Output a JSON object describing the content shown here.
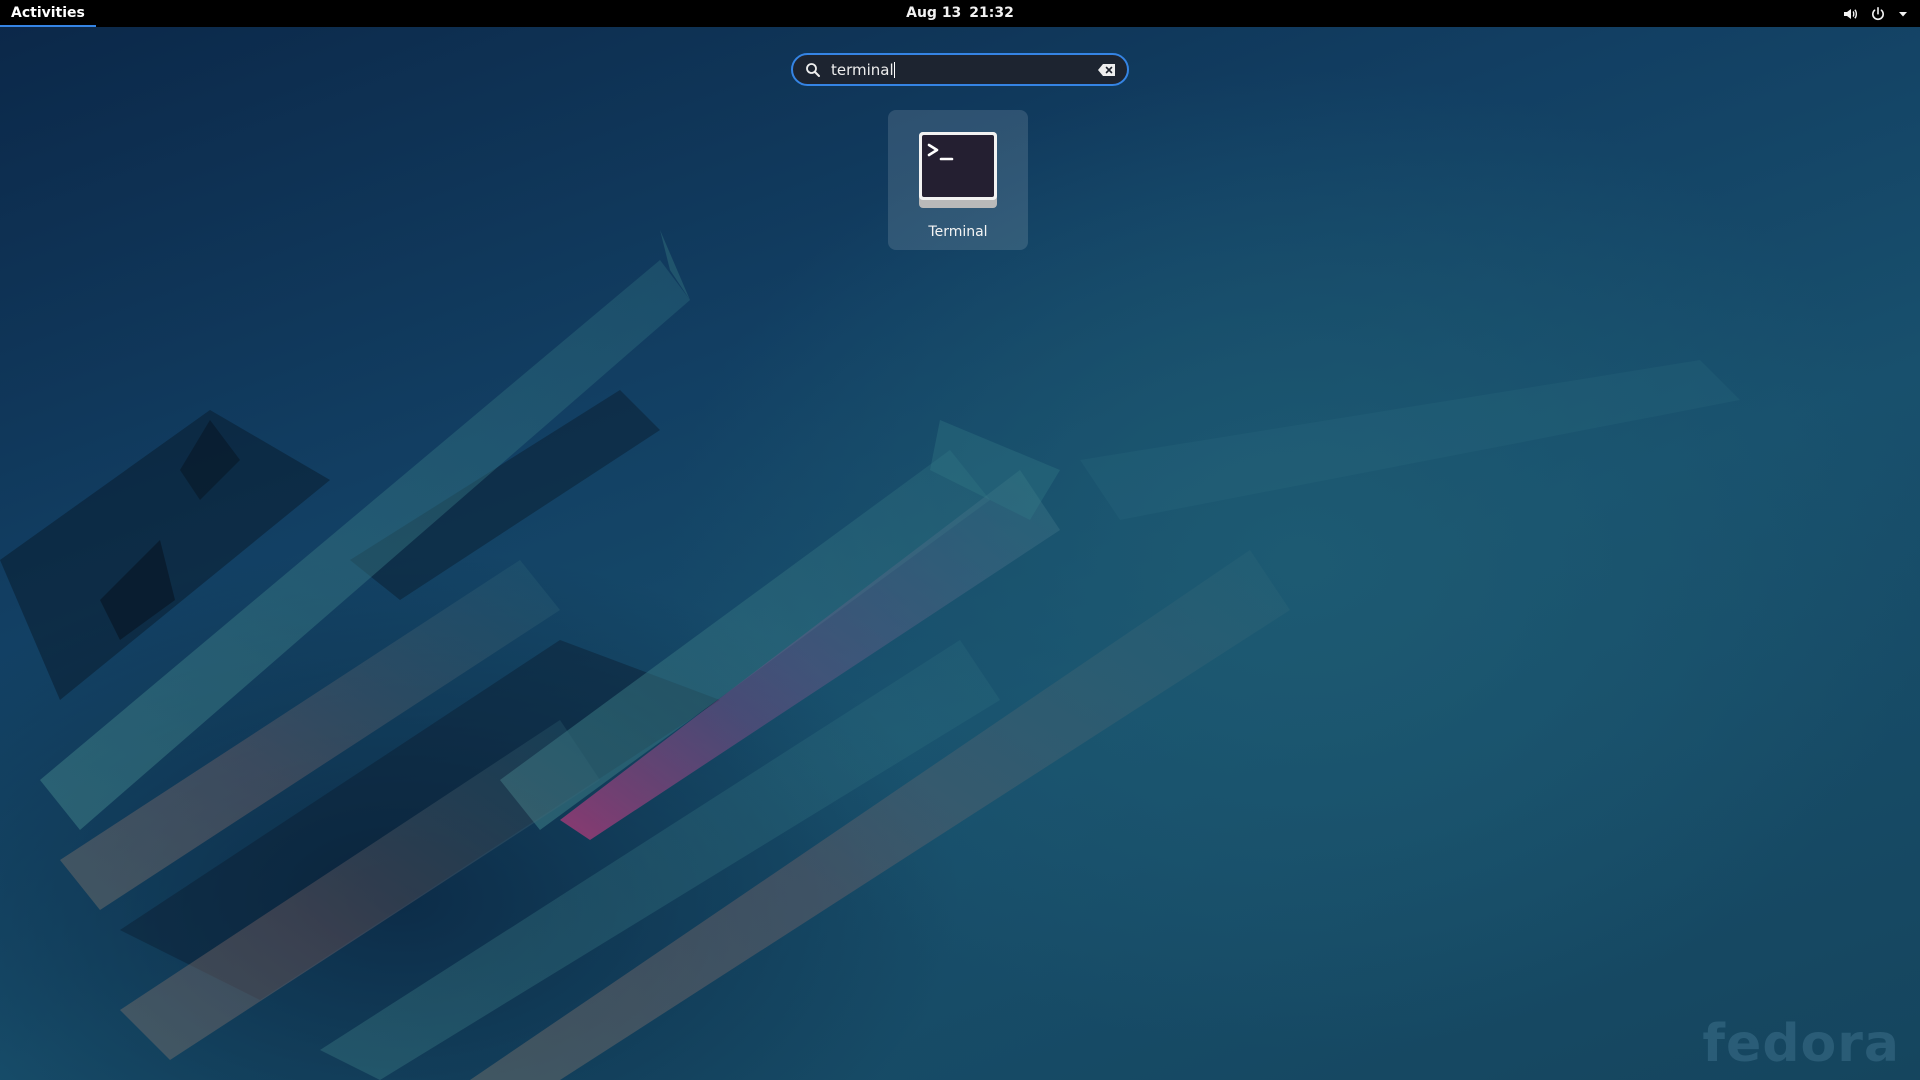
{
  "topbar": {
    "activities_label": "Activities",
    "date": "Aug 13",
    "time": "21:32",
    "icons": [
      "volume-icon",
      "power-icon",
      "dropdown-arrow-icon"
    ]
  },
  "search": {
    "value": "terminal",
    "icon": "search-icon",
    "clear_icon": "clear-text-icon"
  },
  "results": [
    {
      "label": "Terminal",
      "icon": "terminal-app-icon"
    }
  ],
  "wallpaper": {
    "watermark": "fedora"
  },
  "colors": {
    "accent": "#3584e4",
    "topbar": "#000000",
    "wallpaper_base": "#123f63"
  }
}
